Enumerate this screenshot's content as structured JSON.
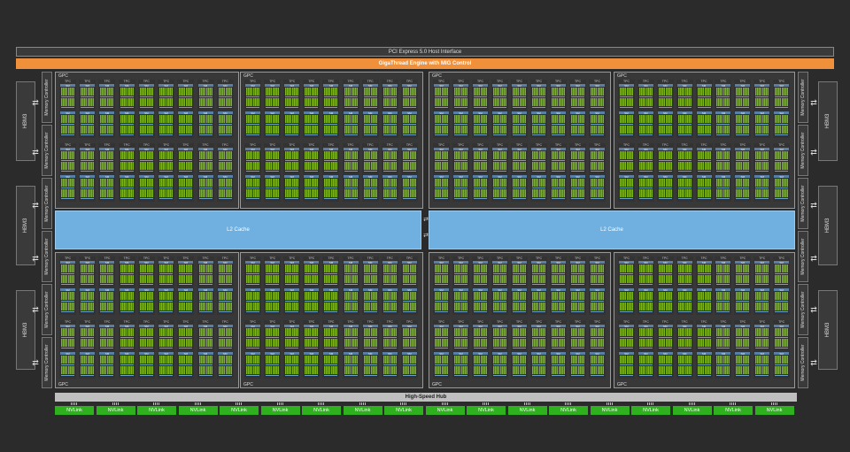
{
  "header": {
    "pcie": "PCI Express 5.0 Host Interface",
    "gigathread": "GigaThread Engine with MIG Control"
  },
  "l2": {
    "label": "L2 Cache"
  },
  "hub": {
    "label": "High-Speed Hub"
  },
  "hbm": {
    "label": "HBM3",
    "count_per_side": 3
  },
  "memory_controller": {
    "label": "Memory Controller"
  },
  "gpc": {
    "label": "GPC",
    "count": 8
  },
  "tpc": {
    "label": "TPC"
  },
  "sm": {
    "label": "SM"
  },
  "nvlink": {
    "label": "NVLink",
    "count": 18
  },
  "colors": {
    "background": "#2b2b2b",
    "gigathread": "#f0903a",
    "l2": "#6fb0e0",
    "nvlink": "#2fb01f",
    "sm_core": "#7fb51f"
  }
}
